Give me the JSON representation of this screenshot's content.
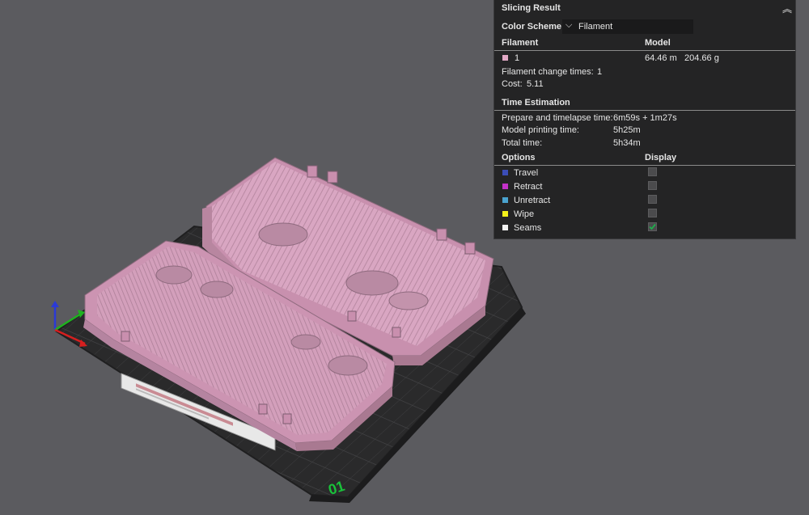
{
  "panel": {
    "title": "Slicing Result",
    "collapse_icon": "double-chevron-up-icon",
    "color_scheme_label": "Color Scheme",
    "color_scheme_value": "Filament",
    "filament_header": "Filament",
    "model_header": "Model",
    "filament": {
      "id": "1",
      "color": "#e2a9c6",
      "length": "64.46 m",
      "weight": "204.66 g"
    },
    "filament_change_label": "Filament change times:",
    "filament_change_value": "1",
    "cost_label": "Cost:",
    "cost_value": "5.11",
    "time_header": "Time Estimation",
    "prepare_label": "Prepare and timelapse time:",
    "prepare_value": "6m59s + 1m27s",
    "model_time_label": "Model printing time:",
    "model_time_value": "5h25m",
    "total_label": "Total time:",
    "total_value": "5h34m",
    "options_header": "Options",
    "display_header": "Display",
    "options": [
      {
        "label": "Travel",
        "color": "#3b4db7",
        "checked": false
      },
      {
        "label": "Retract",
        "color": "#c431c9",
        "checked": false
      },
      {
        "label": "Unretract",
        "color": "#4aa3cf",
        "checked": false
      },
      {
        "label": "Wipe",
        "color": "#f2ef1a",
        "checked": false
      },
      {
        "label": "Seams",
        "color": "#f2f2f2",
        "checked": true
      }
    ]
  },
  "scene": {
    "plate_number": "01",
    "model_color": "#d7a2bf"
  }
}
